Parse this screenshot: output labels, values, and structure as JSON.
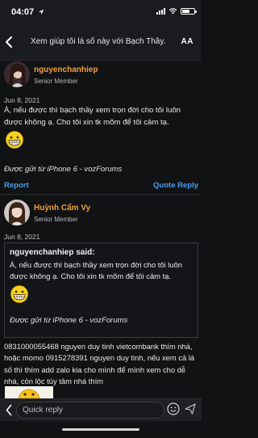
{
  "status": {
    "time": "04:07",
    "battery_level": 0.7
  },
  "nav": {
    "title": "Xem giúp tôi lá số này với Bạch Thầy.",
    "text_size_label": "AA"
  },
  "posts": [
    {
      "username": "nguyenchanhiep",
      "username_color": "#f0a03a",
      "title": "Senior Member",
      "date": "Jun 8, 2021",
      "text": "À, nếu được thì bạch thầy xem trọn đời cho tôi luôn được không ạ. Cho tôi xin tk mõm để tôi cảm tạ.",
      "emoji": "grinning-emoji",
      "signature": "Được gửi từ iPhone 6 - vozForums",
      "report_label": "Report",
      "quote_reply_label": "Quote Reply"
    },
    {
      "username": "Huỳnh Cẩm Vy",
      "username_color": "#f0a03a",
      "title": "Senior Member",
      "date": "Jun 8, 2021",
      "quote": {
        "author": "nguyenchanhiep said:",
        "text": "À, nếu được thì bạch thầy xem trọn đời cho tôi luôn được không ạ. Cho tôi xin tk mõm để tôi cảm tạ.",
        "emoji": "grinning-emoji",
        "signature": "Được gửi từ iPhone 6 - vozForums"
      },
      "text": "0831000055468 nguyen duy tinh vietcombank thím nhá, hoặc momo 0915278391 nguyen duy tinh, nếu xem cả lá số thì thím add zalo kia cho mình để mình xem cho dễ nhá, còn lộc tùy tâm nhá thím"
    }
  ],
  "quick_reply": {
    "placeholder": "Quick reply"
  },
  "colors": {
    "accent": "#4a9ff0",
    "username": "#f0a03a",
    "background": "#111214"
  }
}
